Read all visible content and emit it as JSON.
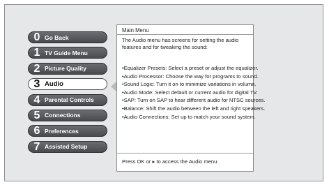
{
  "menu": {
    "items": [
      {
        "num": "0",
        "label": "Go Back"
      },
      {
        "num": "1",
        "label": "TV Guide Menu"
      },
      {
        "num": "2",
        "label": "Picture Quality"
      },
      {
        "num": "3",
        "label": "Audio"
      },
      {
        "num": "4",
        "label": "Parental Controls"
      },
      {
        "num": "5",
        "label": "Connections"
      },
      {
        "num": "6",
        "label": "Preferences"
      },
      {
        "num": "7",
        "label": "Assisted Setup"
      }
    ],
    "selected": "Audio"
  },
  "panel": {
    "title": "Main Menu",
    "intro": "The Audio menu has screens for setting the audio features and for tweaking the sound:",
    "bullets": [
      "•Equalizer Presets: Select a preset or adjust the equalizer.",
      "•Audio Processor: Choose the way for programs to sound.",
      "•Sound Logic: Turn it on to minimize variations in volume.",
      "•Audio Mode: Select default or current audio for digital TV.",
      "•SAP: Turn on SAP to hear different audio for NTSC sources.",
      "•Balance: Shift the audio between the left and right speakers.",
      "•Audio Connections: Set up to match your sound system."
    ],
    "footer": "Press OK or ▸ to access the Audio menu."
  }
}
